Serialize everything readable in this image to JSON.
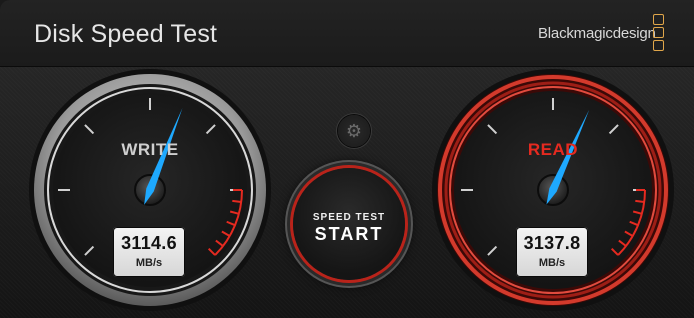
{
  "window": {
    "title": "Disk Speed Test",
    "brand": "Blackmagicdesign"
  },
  "write": {
    "label": "WRITE",
    "value": "3114.6",
    "unit": "MB/s",
    "needle_fraction": 0.58
  },
  "read": {
    "label": "READ",
    "value": "3137.8",
    "unit": "MB/s",
    "needle_fraction": 0.59
  },
  "start_button": {
    "line1": "SPEED TEST",
    "line2": "START"
  },
  "settings": {
    "icon": "gear-icon"
  },
  "colors": {
    "needle": "#1ea9ff",
    "read_accent": "#e52a20",
    "brand_logo": "#e0a64a"
  }
}
